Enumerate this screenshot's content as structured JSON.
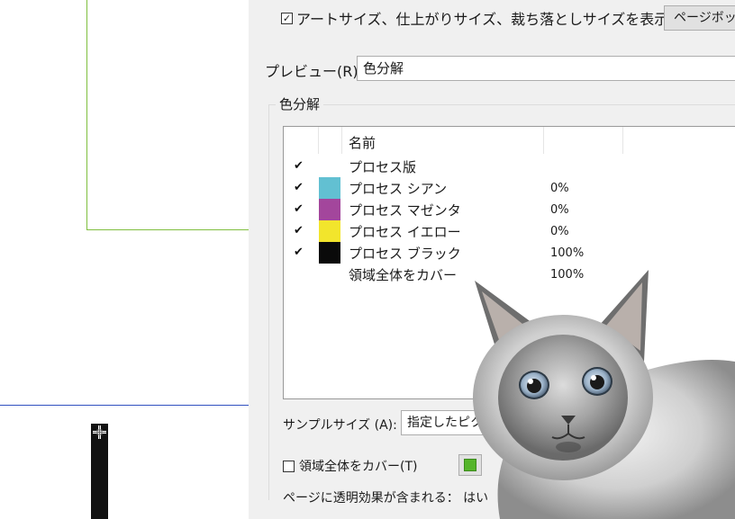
{
  "options": {
    "show_sizes_label": "アートサイズ、仕上がりサイズ、裁ち落としサイズを表示(X)",
    "show_sizes_checked": true,
    "page_box_button": "ページボックス..."
  },
  "preview": {
    "label": "プレビュー(R)：",
    "value": "色分解"
  },
  "separations": {
    "group_title": "色分解",
    "column_name": "名前",
    "rows": [
      {
        "checked": "✔",
        "color": "",
        "name": "プロセス版",
        "percent": ""
      },
      {
        "checked": "✔",
        "color": "#62c0d2",
        "name": "プロセス シアン",
        "percent": "0%"
      },
      {
        "checked": "✔",
        "color": "#a3469c",
        "name": "プロセス マゼンタ",
        "percent": "0%"
      },
      {
        "checked": "✔",
        "color": "#f2e52c",
        "name": "プロセス イエロー",
        "percent": "0%"
      },
      {
        "checked": "✔",
        "color": "#0a0a0a",
        "name": "プロセス ブラック",
        "percent": "100%"
      },
      {
        "checked": "",
        "color": "",
        "name": "領域全体をカバー",
        "percent": "100%"
      }
    ]
  },
  "sample": {
    "label": "サンプルサイズ (A):",
    "value": "指定したピクセル"
  },
  "cover": {
    "label": "領域全体をカバー(T)",
    "checked": false,
    "highlight_color": "#55b52a"
  },
  "transparency": {
    "text": "ページに透明効果が含まれる： はい"
  }
}
